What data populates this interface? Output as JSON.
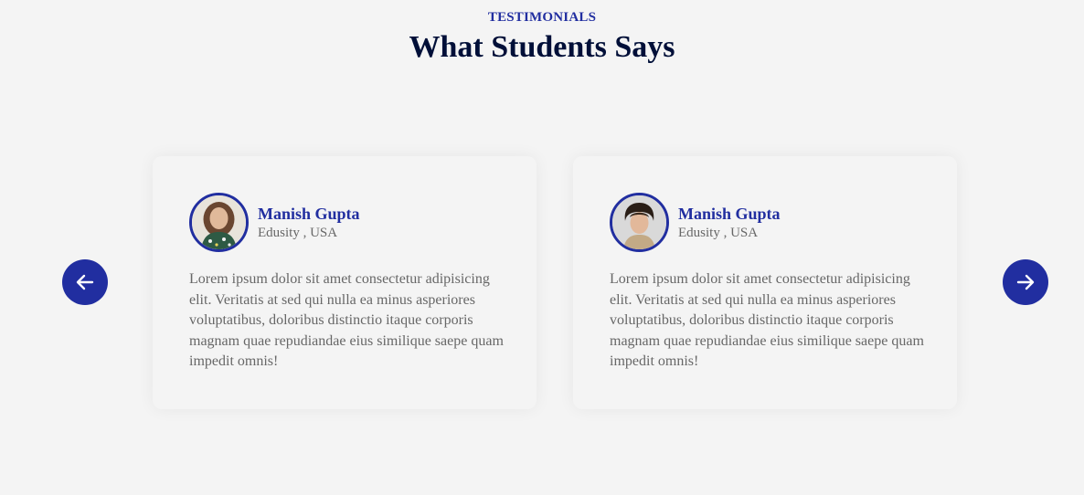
{
  "section": {
    "subtitle": "TESTIMONIALS",
    "title": "What Students Says"
  },
  "navigation": {
    "prev_icon": "arrow-left-icon",
    "next_icon": "arrow-right-icon"
  },
  "testimonials": [
    {
      "name": "Manish Gupta",
      "location": "Edusity , USA",
      "avatar": "woman-portrait",
      "text": "Lorem ipsum dolor sit amet consectetur adipisicing elit. Veritatis at sed qui nulla ea minus asperiores voluptatibus, doloribus distinctio itaque corporis magnam quae repudiandae eius similique saepe quam impedit omnis!"
    },
    {
      "name": "Manish Gupta",
      "location": "Edusity , USA",
      "avatar": "man-portrait",
      "text": "Lorem ipsum dolor sit amet consectetur adipisicing elit. Veritatis at sed qui nulla ea minus asperiores voluptatibus, doloribus distinctio itaque corporis magnam quae repudiandae eius similique saepe quam impedit omnis!"
    }
  ],
  "colors": {
    "accent": "#212ea0",
    "title": "#000f38",
    "text": "#676767",
    "background": "#f4f4f4"
  }
}
